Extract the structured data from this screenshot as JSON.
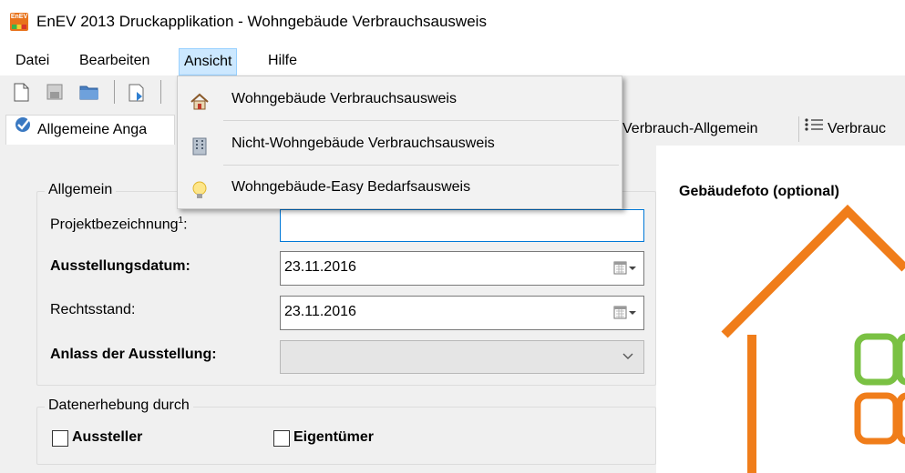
{
  "window": {
    "app_icon_text": "EnEV",
    "title": "EnEV 2013 Druckapplikation - Wohngebäude Verbrauchsausweis"
  },
  "menubar": {
    "items": [
      {
        "label": "Datei"
      },
      {
        "label": "Bearbeiten"
      },
      {
        "label": "Ansicht"
      },
      {
        "label": "Hilfe"
      }
    ],
    "active": "Ansicht"
  },
  "toolbar": {
    "icons": [
      "new-document-icon",
      "save-icon",
      "open-folder-icon",
      "export-document-icon"
    ]
  },
  "tabs": [
    {
      "label": "Allgemeine Anga",
      "icon": "checkmark-globe-icon"
    },
    {
      "label": "Verbrauch-Allgemein"
    },
    {
      "label": "Verbrauc",
      "icon": "list-icon"
    }
  ],
  "dropdown": {
    "items": [
      {
        "label": "Wohngebäude Verbrauchsausweis",
        "icon": "house-icon"
      },
      {
        "label": "Nicht-Wohngebäude Verbrauchsausweis",
        "icon": "office-building-icon"
      },
      {
        "label": "Wohngebäude-Easy Bedarfsausweis",
        "icon": "lightbulb-icon"
      }
    ]
  },
  "form": {
    "group_allgemein": "Allgemein",
    "projekt_label": "Projektbezeichnung",
    "projekt_sup": "1",
    "projekt_label_colon": ":",
    "projekt_value": "",
    "ausstellungsdatum_label": "Ausstellungsdatum:",
    "ausstellungsdatum_value": "23.11.2016",
    "rechtsstand_label": "Rechtsstand:",
    "rechtsstand_value": "23.11.2016",
    "anlass_label": "Anlass der Ausstellung:",
    "anlass_value": "",
    "group_datenerhebung": "Datenerhebung durch",
    "aussteller_label": "Aussteller",
    "aussteller_checked": false,
    "eigentuemer_label": "Eigentümer",
    "eigentuemer_checked": false
  },
  "photo": {
    "title": "Gebäudefoto (optional)",
    "colors": {
      "roof": "#f07d1a",
      "window_green": "#7ac143",
      "window_orange": "#f07d1a"
    }
  },
  "colors": {
    "accent": "#0078d7",
    "menu_highlight": "#cce8ff"
  }
}
